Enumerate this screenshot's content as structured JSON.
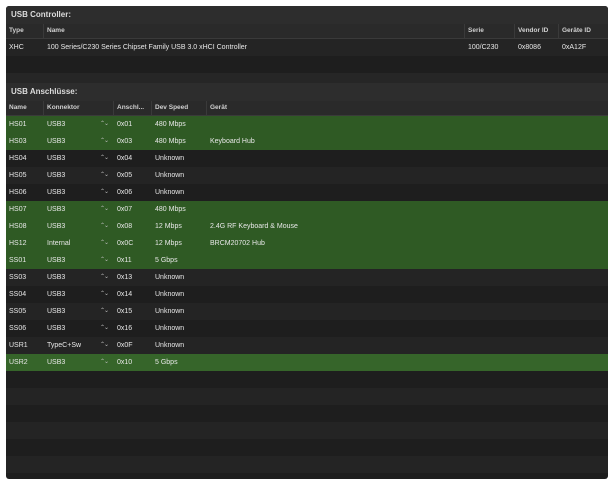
{
  "controller": {
    "title": "USB Controller:",
    "headers": {
      "type": "Type",
      "name": "Name",
      "serie": "Serie",
      "vendor": "Vendor ID",
      "device": "Geräte ID"
    },
    "rows": [
      {
        "type": "XHC",
        "name": "100 Series/C230 Series Chipset Family USB 3.0 xHCI Controller",
        "serie": "100/C230",
        "vendor": "0x8086",
        "device": "0xA12F"
      }
    ]
  },
  "ports": {
    "title": "USB Anschlüsse:",
    "headers": {
      "name": "Name",
      "konnektor": "Konnektor",
      "anschluss": "Anschl...",
      "speed": "Dev Speed",
      "device": "Gerät"
    },
    "rows": [
      {
        "name": "HS01",
        "konnektor": "USB3",
        "addr": "0x01",
        "speed": "480 Mbps",
        "device": "",
        "state": "green"
      },
      {
        "name": "HS03",
        "konnektor": "USB3",
        "addr": "0x03",
        "speed": "480 Mbps",
        "device": "Keyboard Hub",
        "state": "green"
      },
      {
        "name": "HS04",
        "konnektor": "USB3",
        "addr": "0x04",
        "speed": "Unknown",
        "device": "",
        "state": "dark"
      },
      {
        "name": "HS05",
        "konnektor": "USB3",
        "addr": "0x05",
        "speed": "Unknown",
        "device": "",
        "state": "dark"
      },
      {
        "name": "HS06",
        "konnektor": "USB3",
        "addr": "0x06",
        "speed": "Unknown",
        "device": "",
        "state": "dark"
      },
      {
        "name": "HS07",
        "konnektor": "USB3",
        "addr": "0x07",
        "speed": "480 Mbps",
        "device": "",
        "state": "green"
      },
      {
        "name": "HS08",
        "konnektor": "USB3",
        "addr": "0x08",
        "speed": "12 Mbps",
        "device": "2.4G RF Keyboard & Mouse",
        "state": "green"
      },
      {
        "name": "HS12",
        "konnektor": "Internal",
        "addr": "0x0C",
        "speed": "12 Mbps",
        "device": "BRCM20702 Hub",
        "state": "green"
      },
      {
        "name": "SS01",
        "konnektor": "USB3",
        "addr": "0x11",
        "speed": "5 Gbps",
        "device": "",
        "state": "green"
      },
      {
        "name": "SS03",
        "konnektor": "USB3",
        "addr": "0x13",
        "speed": "Unknown",
        "device": "",
        "state": "dark"
      },
      {
        "name": "SS04",
        "konnektor": "USB3",
        "addr": "0x14",
        "speed": "Unknown",
        "device": "",
        "state": "dark"
      },
      {
        "name": "SS05",
        "konnektor": "USB3",
        "addr": "0x15",
        "speed": "Unknown",
        "device": "",
        "state": "dark"
      },
      {
        "name": "SS06",
        "konnektor": "USB3",
        "addr": "0x16",
        "speed": "Unknown",
        "device": "",
        "state": "dark"
      },
      {
        "name": "USR1",
        "konnektor": "TypeC+Sw",
        "addr": "0x0F",
        "speed": "Unknown",
        "device": "",
        "state": "dark"
      },
      {
        "name": "USR2",
        "konnektor": "USB3",
        "addr": "0x10",
        "speed": "5 Gbps",
        "device": "",
        "state": "green"
      }
    ],
    "stepper_glyph": "⌃⌄"
  },
  "colors": {
    "green": "#2f5a24",
    "dark": "#1e1e1e",
    "header": "#2a2a2a"
  }
}
